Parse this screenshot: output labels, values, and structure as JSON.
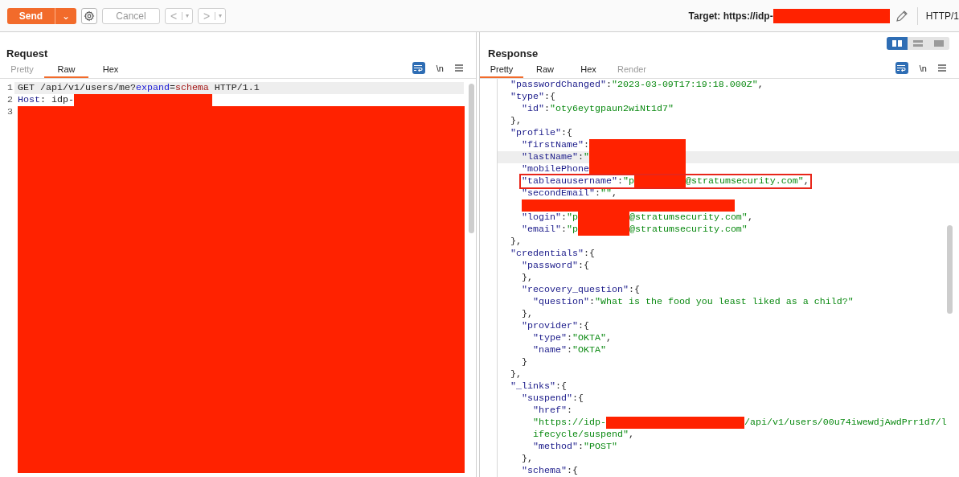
{
  "toolbar": {
    "send": "Send",
    "send_menu": "⌄",
    "cancel": "Cancel",
    "back": "<",
    "back_menu": "▾",
    "forward": ">",
    "forward_menu": "▾",
    "target_label": "Target: https://idp-",
    "target_redaction": {
      "kind": "redaction-target"
    },
    "protocol": "HTTP/1"
  },
  "request": {
    "title": "Request",
    "tabs": [
      {
        "label": "Pretty",
        "selected": false,
        "disabled": true
      },
      {
        "label": "Raw",
        "selected": true,
        "disabled": false
      },
      {
        "label": "Hex",
        "selected": false,
        "disabled": false
      }
    ],
    "newline_toggle": "\\n",
    "wrap_on": true,
    "lines": [
      {
        "number": "1",
        "current": true,
        "tokens": [
          {
            "kind": "plain",
            "text": "GET /api/v1/users/me?"
          },
          {
            "kind": "param",
            "text": "expand"
          },
          {
            "kind": "plain",
            "text": "="
          },
          {
            "kind": "value",
            "text": "schema"
          },
          {
            "kind": "plain",
            "text": " HTTP/1.1"
          }
        ]
      },
      {
        "number": "2",
        "current": false,
        "tokens": [
          {
            "kind": "header",
            "text": "Host"
          },
          {
            "kind": "plain",
            "text": ": idp-"
          },
          {
            "kind": "redaction-xl"
          }
        ]
      },
      {
        "number": "3",
        "current": false,
        "tokens": [
          {
            "kind": "redaction-block"
          }
        ]
      }
    ]
  },
  "response": {
    "title": "Response",
    "tabs": [
      {
        "label": "Pretty",
        "selected": true,
        "disabled": false
      },
      {
        "label": "Raw",
        "selected": false,
        "disabled": false
      },
      {
        "label": "Hex",
        "selected": false,
        "disabled": false
      },
      {
        "label": "Render",
        "selected": false,
        "disabled": true
      }
    ],
    "layouts": [
      {
        "kind": "columns",
        "selected": true
      },
      {
        "kind": "rows",
        "selected": false
      },
      {
        "kind": "single",
        "selected": false
      }
    ],
    "newline_toggle": "\\n",
    "wrap_on": true,
    "lines": [
      {
        "current": false,
        "outlined": false,
        "tokens": [
          {
            "kind": "key",
            "text": "\"passwordChanged\""
          },
          {
            "kind": "punct",
            "text": ":"
          },
          {
            "kind": "str",
            "text": "\"2023-03-09T17:19:18.000Z\""
          },
          {
            "kind": "punct",
            "text": ","
          }
        ]
      },
      {
        "current": false,
        "outlined": false,
        "tokens": [
          {
            "kind": "key",
            "text": "\"type\""
          },
          {
            "kind": "punct",
            "text": ":{"
          }
        ],
        "children": [
          {
            "current": false,
            "outlined": false,
            "tokens": [
              {
                "kind": "key",
                "text": "\"id\""
              },
              {
                "kind": "punct",
                "text": ":"
              },
              {
                "kind": "str",
                "text": "\"oty6eytgpaun2wiNt1d7\""
              }
            ]
          }
        ]
      },
      {
        "current": false,
        "outlined": false,
        "tokens": [
          {
            "kind": "punct",
            "text": "},"
          }
        ]
      },
      {
        "current": false,
        "outlined": false,
        "tokens": [
          {
            "kind": "key",
            "text": "\"profile\""
          },
          {
            "kind": "punct",
            "text": ":{"
          }
        ],
        "children": [
          {
            "current": false,
            "outlined": false,
            "tokens": [
              {
                "kind": "key",
                "text": "\"firstName\""
              },
              {
                "kind": "punct",
                "text": ":"
              },
              {
                "kind": "redaction-md"
              }
            ]
          },
          {
            "current": true,
            "outlined": false,
            "tokens": [
              {
                "kind": "key",
                "text": "\"lastName\""
              },
              {
                "kind": "punct",
                "text": ":"
              },
              {
                "kind": "str",
                "text": "\""
              },
              {
                "kind": "redaction-md"
              }
            ]
          },
          {
            "current": false,
            "outlined": false,
            "tokens": [
              {
                "kind": "key",
                "text": "\"mobilePhone"
              },
              {
                "kind": "redaction-md"
              }
            ]
          },
          {
            "current": false,
            "outlined": true,
            "tokens": [
              {
                "kind": "key",
                "text": "\"tableauusername\""
              },
              {
                "kind": "punct",
                "text": ":"
              },
              {
                "kind": "str",
                "text": "\"p"
              },
              {
                "kind": "redaction-sm"
              },
              {
                "kind": "str",
                "text": "@stratumsecurity.com\""
              },
              {
                "kind": "punct",
                "text": ","
              }
            ]
          },
          {
            "current": false,
            "outlined": false,
            "tokens": [
              {
                "kind": "key",
                "text": "\"secondEmail\""
              },
              {
                "kind": "punct",
                "text": ":"
              },
              {
                "kind": "str",
                "text": "\"\""
              },
              {
                "kind": "punct",
                "text": ","
              }
            ]
          },
          {
            "current": false,
            "outlined": false,
            "tokens": [
              {
                "kind": "redaction-lg"
              }
            ]
          },
          {
            "current": false,
            "outlined": false,
            "tokens": [
              {
                "kind": "key",
                "text": "\"login\""
              },
              {
                "kind": "punct",
                "text": ":"
              },
              {
                "kind": "str",
                "text": "\"p"
              },
              {
                "kind": "redaction-sm"
              },
              {
                "kind": "str",
                "text": "@stratumsecurity.com\""
              },
              {
                "kind": "punct",
                "text": ","
              }
            ]
          },
          {
            "current": false,
            "outlined": false,
            "tokens": [
              {
                "kind": "key",
                "text": "\"email\""
              },
              {
                "kind": "punct",
                "text": ":"
              },
              {
                "kind": "str",
                "text": "\"p"
              },
              {
                "kind": "redaction-sm"
              },
              {
                "kind": "str",
                "text": "@stratumsecurity.com\""
              }
            ]
          }
        ]
      },
      {
        "current": false,
        "outlined": false,
        "tokens": [
          {
            "kind": "punct",
            "text": "},"
          }
        ]
      },
      {
        "current": false,
        "outlined": false,
        "tokens": [
          {
            "kind": "key",
            "text": "\"credentials\""
          },
          {
            "kind": "punct",
            "text": ":{"
          }
        ],
        "children": [
          {
            "current": false,
            "outlined": false,
            "tokens": [
              {
                "kind": "key",
                "text": "\"password\""
              },
              {
                "kind": "punct",
                "text": ":{"
              }
            ]
          },
          {
            "current": false,
            "outlined": false,
            "tokens": [
              {
                "kind": "punct",
                "text": "},"
              }
            ]
          },
          {
            "current": false,
            "outlined": false,
            "tokens": [
              {
                "kind": "key",
                "text": "\"recovery_question\""
              },
              {
                "kind": "punct",
                "text": ":{"
              }
            ],
            "children": [
              {
                "current": false,
                "outlined": false,
                "tokens": [
                  {
                    "kind": "key",
                    "text": "\"question\""
                  },
                  {
                    "kind": "punct",
                    "text": ":"
                  },
                  {
                    "kind": "str",
                    "text": "\"What is the food you least liked as a child?\""
                  }
                ]
              }
            ]
          },
          {
            "current": false,
            "outlined": false,
            "tokens": [
              {
                "kind": "punct",
                "text": "},"
              }
            ]
          },
          {
            "current": false,
            "outlined": false,
            "tokens": [
              {
                "kind": "key",
                "text": "\"provider\""
              },
              {
                "kind": "punct",
                "text": ":{"
              }
            ],
            "children": [
              {
                "current": false,
                "outlined": false,
                "tokens": [
                  {
                    "kind": "key",
                    "text": "\"type\""
                  },
                  {
                    "kind": "punct",
                    "text": ":"
                  },
                  {
                    "kind": "str",
                    "text": "\"OKTA\""
                  },
                  {
                    "kind": "punct",
                    "text": ","
                  }
                ]
              },
              {
                "current": false,
                "outlined": false,
                "tokens": [
                  {
                    "kind": "key",
                    "text": "\"name\""
                  },
                  {
                    "kind": "punct",
                    "text": ":"
                  },
                  {
                    "kind": "str",
                    "text": "\"OKTA\""
                  }
                ]
              }
            ]
          },
          {
            "current": false,
            "outlined": false,
            "tokens": [
              {
                "kind": "punct",
                "text": "}"
              }
            ]
          }
        ]
      },
      {
        "current": false,
        "outlined": false,
        "tokens": [
          {
            "kind": "punct",
            "text": "},"
          }
        ]
      },
      {
        "current": false,
        "outlined": false,
        "tokens": [
          {
            "kind": "key",
            "text": "\"_links\""
          },
          {
            "kind": "punct",
            "text": ":{"
          }
        ],
        "children": [
          {
            "current": false,
            "outlined": false,
            "tokens": [
              {
                "kind": "key",
                "text": "\"suspend\""
              },
              {
                "kind": "punct",
                "text": ":{"
              }
            ],
            "children": [
              {
                "current": false,
                "outlined": false,
                "tokens": [
                  {
                    "kind": "key",
                    "text": "\"href\""
                  },
                  {
                    "kind": "punct",
                    "text": ":"
                  }
                ]
              },
              {
                "current": false,
                "outlined": false,
                "tokens": [
                  {
                    "kind": "str",
                    "text": "\"https://idp-"
                  },
                  {
                    "kind": "redaction-xl"
                  },
                  {
                    "kind": "str",
                    "text": "/api/v1/users/00u74iwewdjAwdPrr1d7/l"
                  }
                ]
              },
              {
                "current": false,
                "outlined": false,
                "tokens": [
                  {
                    "kind": "str",
                    "text": "ifecycle/suspend\""
                  },
                  {
                    "kind": "punct",
                    "text": ","
                  }
                ]
              },
              {
                "current": false,
                "outlined": false,
                "tokens": [
                  {
                    "kind": "key",
                    "text": "\"method\""
                  },
                  {
                    "kind": "punct",
                    "text": ":"
                  },
                  {
                    "kind": "str",
                    "text": "\"POST\""
                  }
                ]
              }
            ]
          },
          {
            "current": false,
            "outlined": false,
            "tokens": [
              {
                "kind": "punct",
                "text": "},"
              }
            ]
          },
          {
            "current": false,
            "outlined": false,
            "tokens": [
              {
                "kind": "key",
                "text": "\"schema\""
              },
              {
                "kind": "punct",
                "text": ":{"
              }
            ]
          }
        ]
      }
    ]
  }
}
